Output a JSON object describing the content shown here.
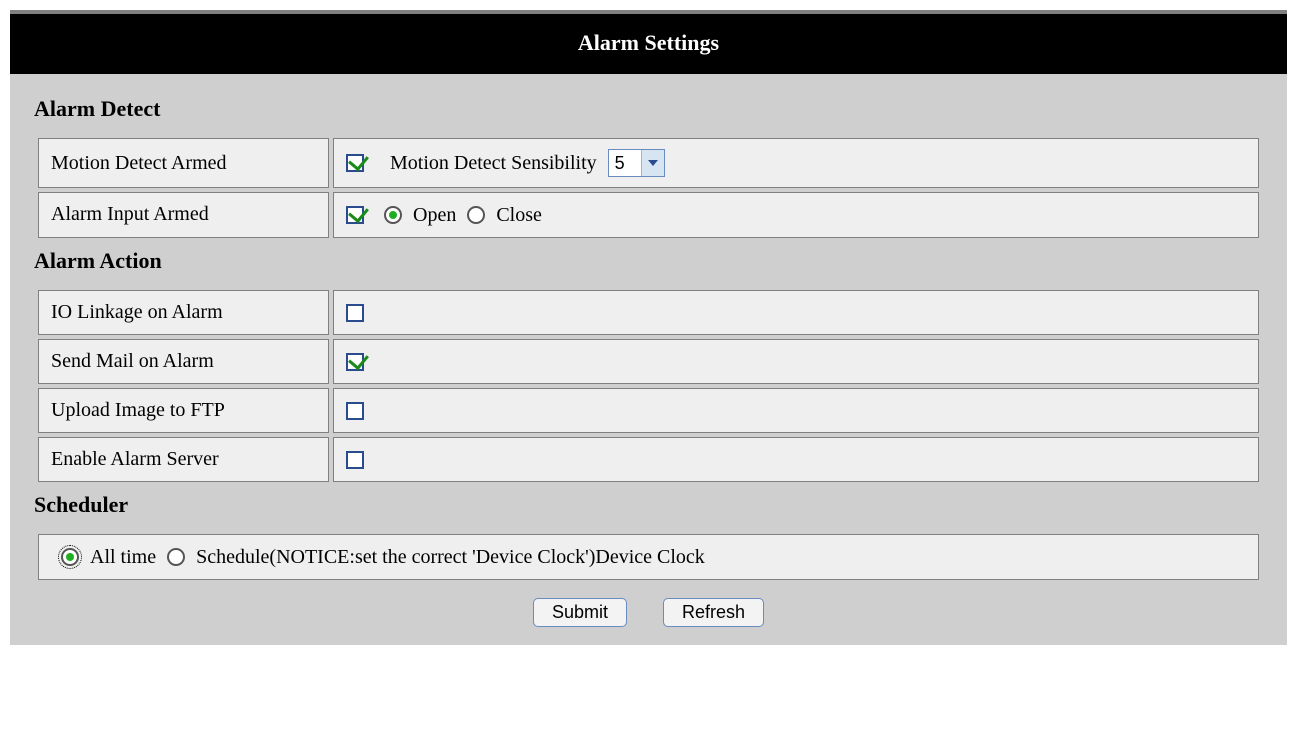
{
  "header": {
    "title": "Alarm Settings"
  },
  "sections": {
    "detect": {
      "title": "Alarm Detect",
      "motion_label": "Motion Detect Armed",
      "motion_checked": true,
      "sensibility_label": "Motion Detect Sensibility",
      "sensibility_value": "5",
      "input_label": "Alarm Input Armed",
      "input_checked": true,
      "mode_open_label": "Open",
      "mode_close_label": "Close",
      "mode_selected": "open"
    },
    "action": {
      "title": "Alarm Action",
      "rows": [
        {
          "key": "io",
          "label": "IO Linkage on Alarm",
          "checked": false
        },
        {
          "key": "mail",
          "label": "Send Mail on Alarm",
          "checked": true
        },
        {
          "key": "ftp",
          "label": "Upload Image to FTP",
          "checked": false
        },
        {
          "key": "server",
          "label": "Enable Alarm Server",
          "checked": false
        }
      ]
    },
    "scheduler": {
      "title": "Scheduler",
      "alltime_label": "All time",
      "schedule_label": "Schedule(NOTICE:set the correct 'Device Clock')Device Clock",
      "selected": "alltime"
    }
  },
  "buttons": {
    "submit": "Submit",
    "refresh": "Refresh"
  }
}
